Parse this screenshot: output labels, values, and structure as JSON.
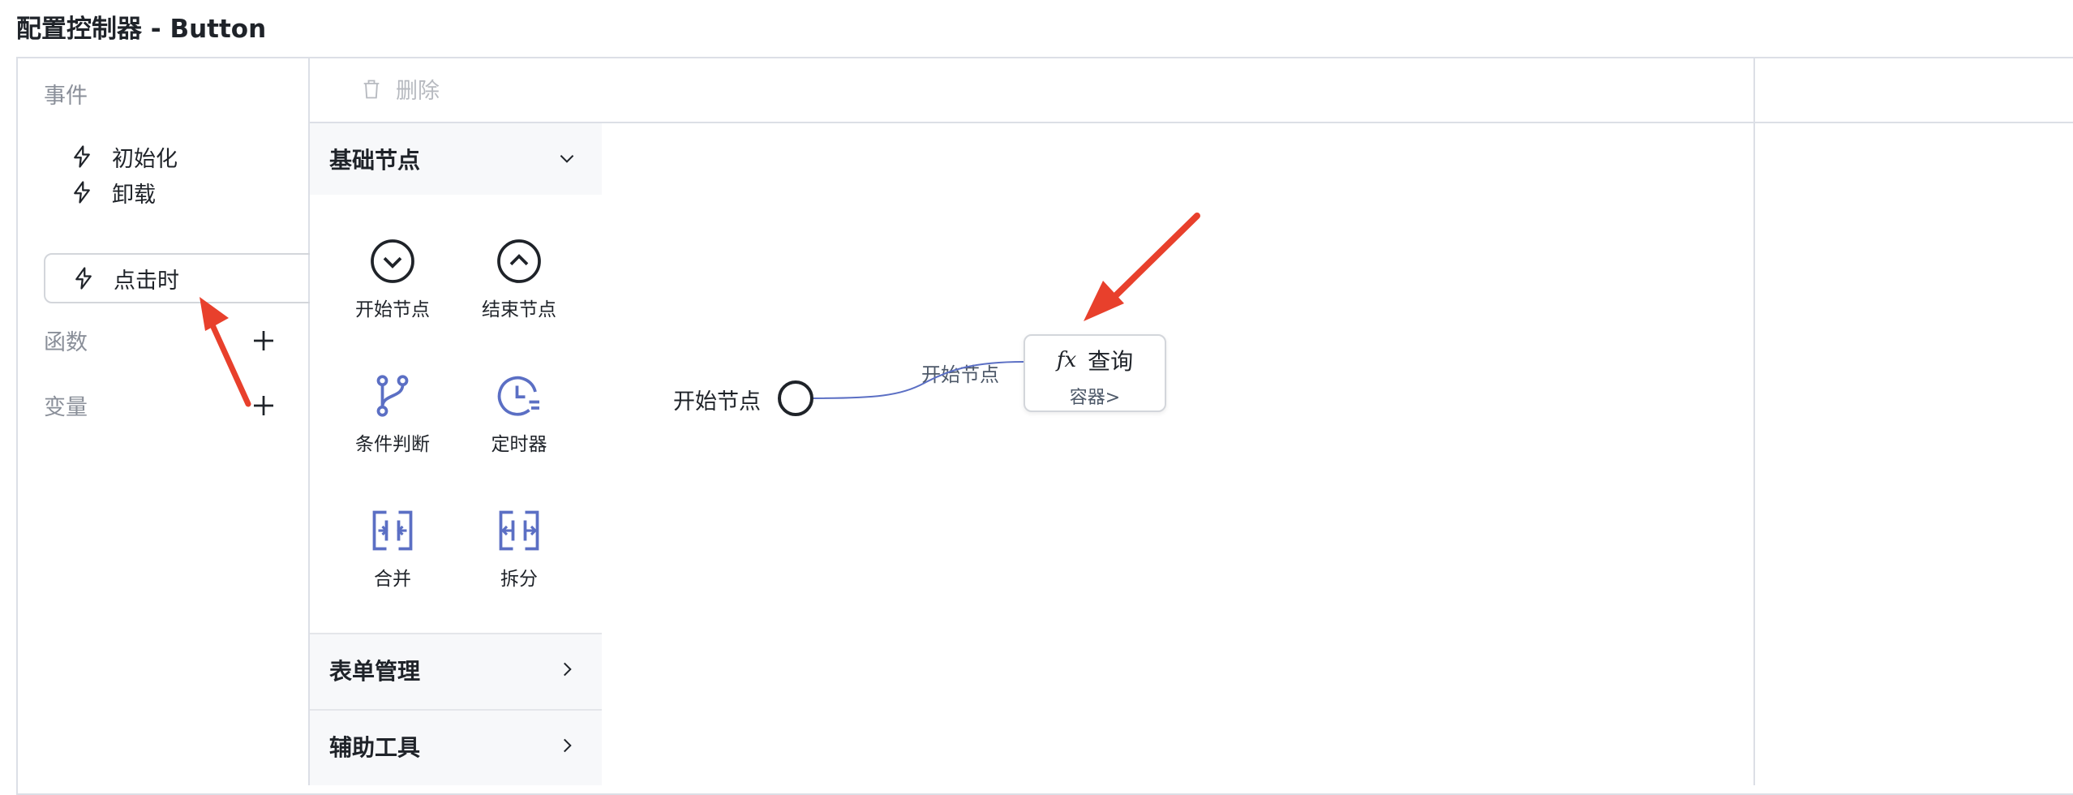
{
  "window": {
    "title": "配置控制器 - Button"
  },
  "sidebar": {
    "events_label": "事件",
    "events": [
      {
        "label": "初始化",
        "icon": "lightning-icon"
      },
      {
        "label": "卸载",
        "icon": "lightning-icon"
      },
      {
        "label": "点击时",
        "icon": "lightning-icon",
        "active": true
      }
    ],
    "functions_label": "函数",
    "variables_label": "变量"
  },
  "toolbar": {
    "delete_label": "删除"
  },
  "palette": {
    "basic": {
      "title": "基础节点",
      "expanded": true,
      "items": [
        {
          "label": "开始节点",
          "icon": "circle-chevron-down-icon"
        },
        {
          "label": "结束节点",
          "icon": "circle-chevron-up-icon"
        },
        {
          "label": "条件判断",
          "icon": "branch-icon"
        },
        {
          "label": "定时器",
          "icon": "clock-icon"
        },
        {
          "label": "合并",
          "icon": "merge-icon"
        },
        {
          "label": "拆分",
          "icon": "split-icon"
        }
      ]
    },
    "form": {
      "title": "表单管理"
    },
    "tools": {
      "title": "辅助工具"
    }
  },
  "canvas": {
    "start_node_label": "开始节点",
    "edge_label": "开始节点",
    "query_node": {
      "icon_text": "fx",
      "title": "查询",
      "subtitle": "容器>"
    }
  },
  "colors": {
    "accent": "#5b6fc4",
    "annotation_arrow": "#e8402c",
    "border": "#dcdfe6"
  }
}
